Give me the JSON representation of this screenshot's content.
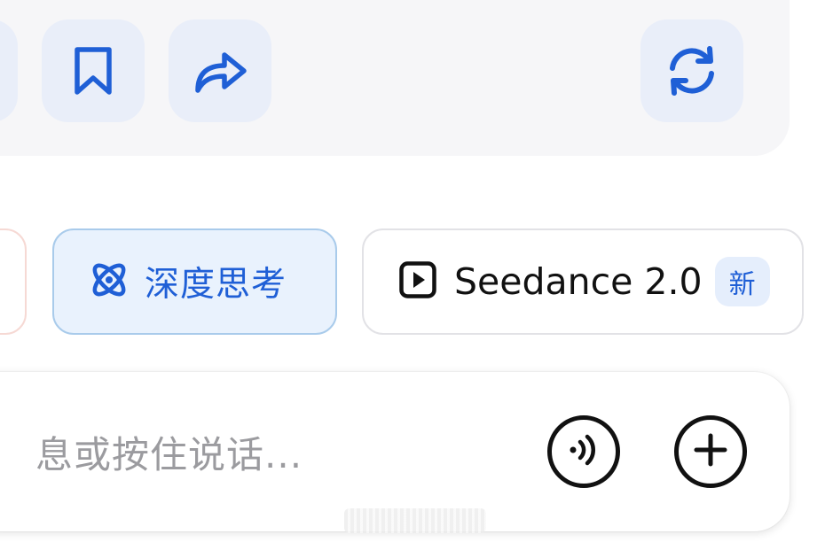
{
  "actions": {
    "bookmark_icon": "bookmark-icon",
    "share_icon": "share-icon",
    "regenerate_icon": "refresh-icon"
  },
  "chips": {
    "deep_think": {
      "label": "深度思考",
      "icon": "atom-icon",
      "selected": true
    },
    "seedance": {
      "label": "Seedance 2.0",
      "icon": "play-icon",
      "badge": "新"
    }
  },
  "composer": {
    "placeholder": "息或按住说话...",
    "voice_icon": "voice-icon",
    "add_icon": "plus-icon"
  },
  "colors": {
    "accent_blue": "#1f5fd6",
    "action_button_bg": "#e9eef9",
    "selected_chip_bg": "#e9f2fd",
    "selected_chip_border": "#a9cbeb",
    "panel_bg": "#f6f6f8",
    "placeholder_text": "#9b9b9f"
  }
}
